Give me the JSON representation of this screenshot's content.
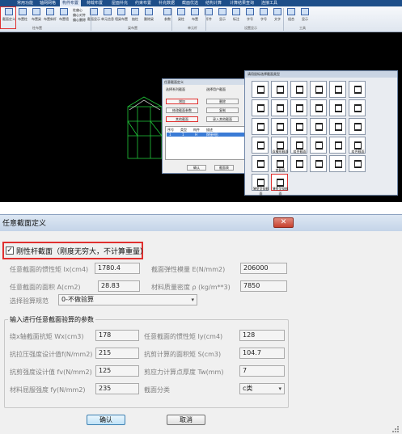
{
  "top_app": {
    "tabs": [
      "常用功能",
      "轴网网格",
      "构件布置",
      "荷载布置",
      "屋面补充",
      "约束布置",
      "补充数据",
      "截面优选",
      "结构计算",
      "计算结果查询",
      "连接工具"
    ],
    "active_tab": 2,
    "ribbon_buttons": [
      "截面定义",
      "布置柱",
      "布置梁",
      "布置斜杆",
      "布置墙",
      "截面显示",
      "单元信息",
      "墙梁布置",
      "抽柱",
      "删除梁",
      "参数",
      "梁柱",
      "布置",
      "杆件",
      "显示",
      "标注",
      "字号",
      "字号",
      "文字",
      "组合",
      "显示"
    ],
    "small_commands": [
      "柱偏心",
      "偏心对齐",
      "偏心删除"
    ],
    "groups": [
      "柱布置",
      "梁布置",
      "单元杆",
      "设置显示",
      "工具"
    ],
    "dialog1": {
      "title": "任意截面定义",
      "radio1": "选择系列截面",
      "radio2": "选择用户截面",
      "btn_add": "增加",
      "btn_delete": "删除",
      "btn_modify": "修改截面参数",
      "btn_copy": "复制",
      "btn_other": "其他截面",
      "btn_input": "录入其他截面",
      "list_headers": [
        "序号",
        "类型",
        "构件",
        "描述"
      ],
      "list_row": [
        "1",
        "1",
        "H",
        "焊接H形"
      ],
      "ok": "确认",
      "cancel": "截面表"
    },
    "palette": {
      "title": "请用鼠标选择截面类型",
      "labels": [
        "双槽形截面",
        "组合截面",
        "组合截面",
        "变截面",
        "薄壁型钢截面",
        "薄壁型钢截面",
        "薄壁型钢截面",
        "薄壁型钢截面",
        "薄壁卷边截面",
        "任意截面"
      ]
    }
  },
  "dialog": {
    "title": "任意截面定义",
    "close_label": "✕",
    "checkbox_label": "刚性杆截面（刚度无穷大，不计算重量）",
    "checkbox_checked": true,
    "rows": [
      {
        "l1": "任意截面的惯性矩 Ix(cm4)",
        "v1": "1780.4",
        "l2": "截面弹性模量 E(N/mm2)",
        "v2": "206000"
      },
      {
        "l1": "任意截面的面积 A(cm2)",
        "v1": "28.83",
        "l2": "材料质量密度 ρ (kg/m**3)",
        "v2": "7850"
      }
    ],
    "check_rule_label": "选择验算规范",
    "check_rule_value": "0-不做验算",
    "group_title": "输入进行任意截面验算的参数",
    "group_rows": [
      {
        "l1": "绕x轴截面抗矩 Wx(cm3)",
        "v1": "178",
        "l2": "任意截面的惯性矩 Iy(cm4)",
        "v2": "128"
      },
      {
        "l1": "抗拉压强度设计值f(N/mm2)",
        "v1": "215",
        "l2": "抗剪计算的面积矩 S(cm3)",
        "v2": "104.7"
      },
      {
        "l1": "抗剪强度设计值 fv(N/mm2)",
        "v1": "125",
        "l2": "剪应力计算点厚度 Tw(mm)",
        "v2": "7"
      },
      {
        "l1": "材料屈服强度 fy(N/mm2)",
        "v1": "235",
        "l2": "截面分类",
        "v2": "c类"
      }
    ],
    "ok_label": "确认",
    "cancel_label": "取消"
  },
  "colors": {
    "highlight": "#e0302f",
    "title_bar": "#c4d4e8",
    "cad_bg": "#000000",
    "cad_green": "#21c83a",
    "ribbon_tab": "#1d4e89"
  }
}
